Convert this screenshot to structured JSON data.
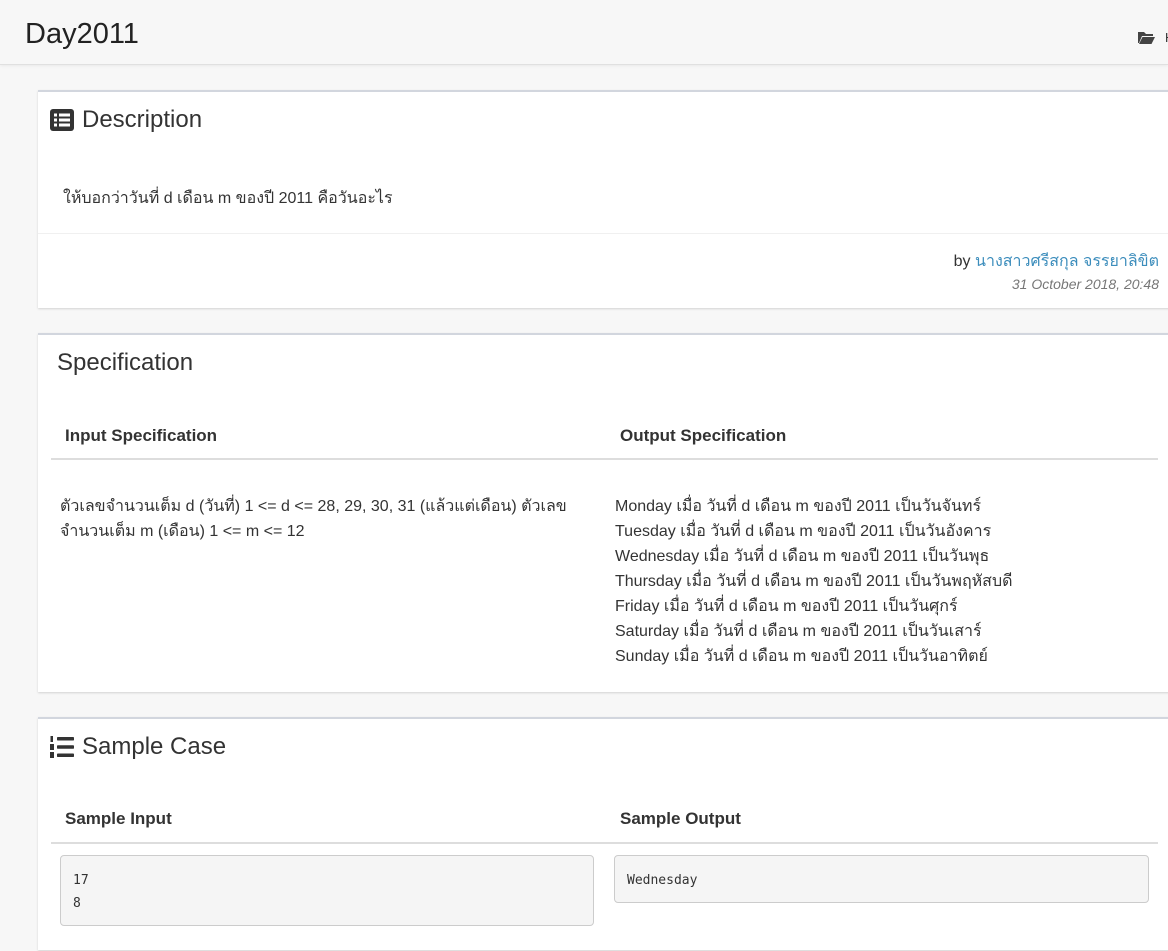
{
  "header": {
    "title": "Day2011",
    "breadcrumb_icon": "folder-open-icon",
    "breadcrumb_text": "H"
  },
  "description": {
    "icon": "list-alt-icon",
    "title": "Description",
    "text": "ให้บอกว่าวันที่ d เดือน m ของปี 2011 คือวันอะไร",
    "by_label": "by",
    "author": "นางสาวศรีสกุล จรรยาลิขิต",
    "date": "31 October 2018, 20:48"
  },
  "specification": {
    "title": "Specification",
    "input_header": "Input Specification",
    "output_header": "Output Specification",
    "input_lines": [
      "ตัวเลขจำนวนเต็ม d (วันที่) 1 <= d <= 28, 29, 30, 31 (แล้วแต่เดือน) ตัวเลข",
      "จำนวนเต็ม m (เดือน) 1 <= m <= 12"
    ],
    "output_lines": [
      "Monday เมื่อ วันที่ d เดือน m ของปี 2011 เป็นวันจันทร์",
      "Tuesday เมื่อ วันที่ d เดือน m ของปี 2011 เป็นวันอังคาร",
      "Wednesday เมื่อ วันที่ d เดือน m ของปี 2011 เป็นวันพุธ",
      "Thursday เมื่อ วันที่ d เดือน m ของปี 2011 เป็นวันพฤหัสบดี",
      "Friday เมื่อ วันที่ d เดือน m ของปี 2011 เป็นวันศุกร์",
      "Saturday เมื่อ วันที่ d เดือน m ของปี 2011 เป็นวันเสาร์",
      "Sunday เมื่อ วันที่ d เดือน m ของปี 2011 เป็นวันอาทิตย์"
    ]
  },
  "sample": {
    "icon": "list-ol-icon",
    "title": "Sample Case",
    "input_header": "Sample Input",
    "output_header": "Sample Output",
    "input_value": "17\n8",
    "output_value": "Wednesday"
  }
}
